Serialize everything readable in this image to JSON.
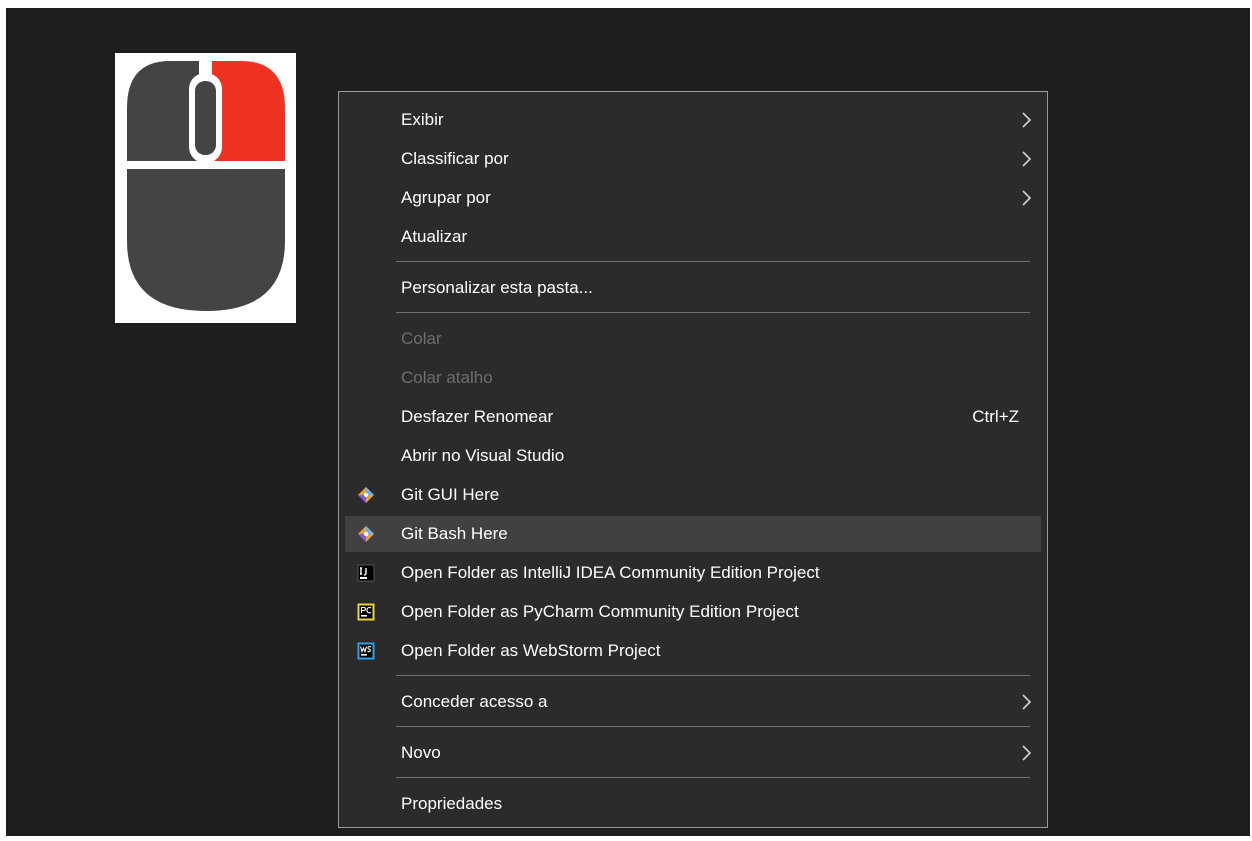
{
  "colors": {
    "desktop_bg": "#1e1e1e",
    "menu_bg": "#2b2b2b",
    "menu_border": "#9a9a9a",
    "hover_bg": "#414141",
    "text": "#ffffff",
    "disabled_text": "#6d6d6d",
    "mouse_body": "#444444",
    "mouse_right_button": "#ee3322"
  },
  "image": {
    "icon": "mouse-right-click-icon"
  },
  "menu": {
    "items": [
      {
        "label": "Exibir",
        "submenu": true
      },
      {
        "label": "Classificar por",
        "submenu": true
      },
      {
        "label": "Agrupar por",
        "submenu": true
      },
      {
        "label": "Atualizar"
      },
      {
        "label": "Personalizar esta pasta..."
      },
      {
        "label": "Colar",
        "disabled": true
      },
      {
        "label": "Colar atalho",
        "disabled": true
      },
      {
        "label": "Desfazer Renomear",
        "shortcut": "Ctrl+Z"
      },
      {
        "label": "Abrir no Visual Studio"
      },
      {
        "label": "Git GUI Here",
        "icon": "git-gui-icon"
      },
      {
        "label": "Git Bash Here",
        "icon": "git-bash-icon",
        "highlighted": true
      },
      {
        "label": "Open Folder as IntelliJ IDEA Community Edition Project",
        "icon": "intellij-icon"
      },
      {
        "label": "Open Folder as PyCharm Community Edition Project",
        "icon": "pycharm-icon"
      },
      {
        "label": "Open Folder as WebStorm Project",
        "icon": "webstorm-icon"
      },
      {
        "label": "Conceder acesso a",
        "submenu": true
      },
      {
        "label": "Novo",
        "submenu": true
      },
      {
        "label": "Propriedades"
      }
    ]
  }
}
